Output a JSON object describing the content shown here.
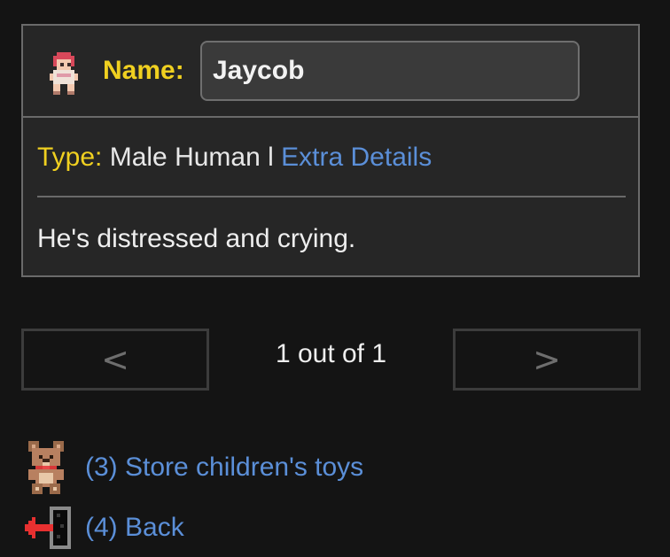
{
  "character": {
    "avatar_icon": "baby-icon",
    "name_label": "Name:",
    "name_value": "Jaycob",
    "type_label": "Type:",
    "type_value": "Male Human",
    "type_separator": "l",
    "extra_details_link": "Extra Details",
    "description": "He's distressed and crying."
  },
  "pager": {
    "prev_label": "<",
    "next_label": ">",
    "status": "1 out of 1"
  },
  "actions": [
    {
      "label": "(3) Store children's toys",
      "icon": "teddy-bear-icon"
    },
    {
      "label": "(4) Back",
      "icon": "exit-door-arrow-icon"
    }
  ],
  "colors": {
    "background": "#141414",
    "panel": "#262626",
    "label_yellow": "#f0d020",
    "link_blue": "#5b8fd8"
  }
}
